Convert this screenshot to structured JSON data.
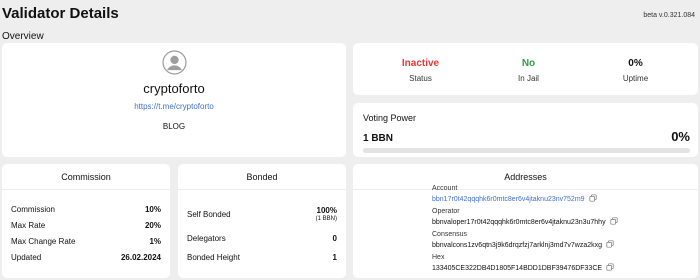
{
  "page": {
    "title": "Validator Details",
    "version": "beta v.0.321.084",
    "section": "Overview"
  },
  "profile": {
    "name": "cryptoforto",
    "link": "https://t.me/cryptoforto",
    "tag": "BLOG",
    "avatar_icon": "user-avatar-icon"
  },
  "status": [
    {
      "value": "Inactive",
      "label": "Status",
      "color": "#e53935"
    },
    {
      "value": "No",
      "label": "In Jail",
      "color": "#2e9e44"
    },
    {
      "value": "0%",
      "label": "Uptime",
      "color": "#111111"
    }
  ],
  "voting_power": {
    "title": "Voting Power",
    "value": "1 BBN",
    "percent": "0%",
    "fill_fraction": 0
  },
  "commission": {
    "title": "Commission",
    "rows": [
      {
        "label": "Commission",
        "value": "10%"
      },
      {
        "label": "Max Rate",
        "value": "20%"
      },
      {
        "label": "Max Change Rate",
        "value": "1%"
      },
      {
        "label": "Updated",
        "value": "26.02.2024"
      }
    ]
  },
  "bonded": {
    "title": "Bonded",
    "self_bonded": {
      "label": "Self Bonded",
      "value": "100%",
      "sub": "(1 BBN)"
    },
    "delegators": {
      "label": "Delegators",
      "value": "0"
    },
    "height": {
      "label": "Bonded Height",
      "value": "1"
    }
  },
  "addresses": {
    "title": "Addresses",
    "account": {
      "label": "Account",
      "value": "bbn17r0t42qqqhk6r0mtc8er6v4jtaknu23nv752m9"
    },
    "operator": {
      "label": "Operator",
      "value": "bbnvaloper17r0t42qqqhk6r0mtc8er6v4jtaknu23n3u7hhy"
    },
    "consensus": {
      "label": "Consensus",
      "value": "bbnvalcons1zv6qtn3j9k6drqzfzj7arklnj3md7v7wza2kxg"
    },
    "hex": {
      "label": "Hex",
      "value": "133405CE322DB4D1805F14BDD1DBF39476DF33CE"
    }
  },
  "colors": {
    "accent": "#3f6fd1",
    "background": "#eeeeee",
    "card": "#ffffff"
  }
}
